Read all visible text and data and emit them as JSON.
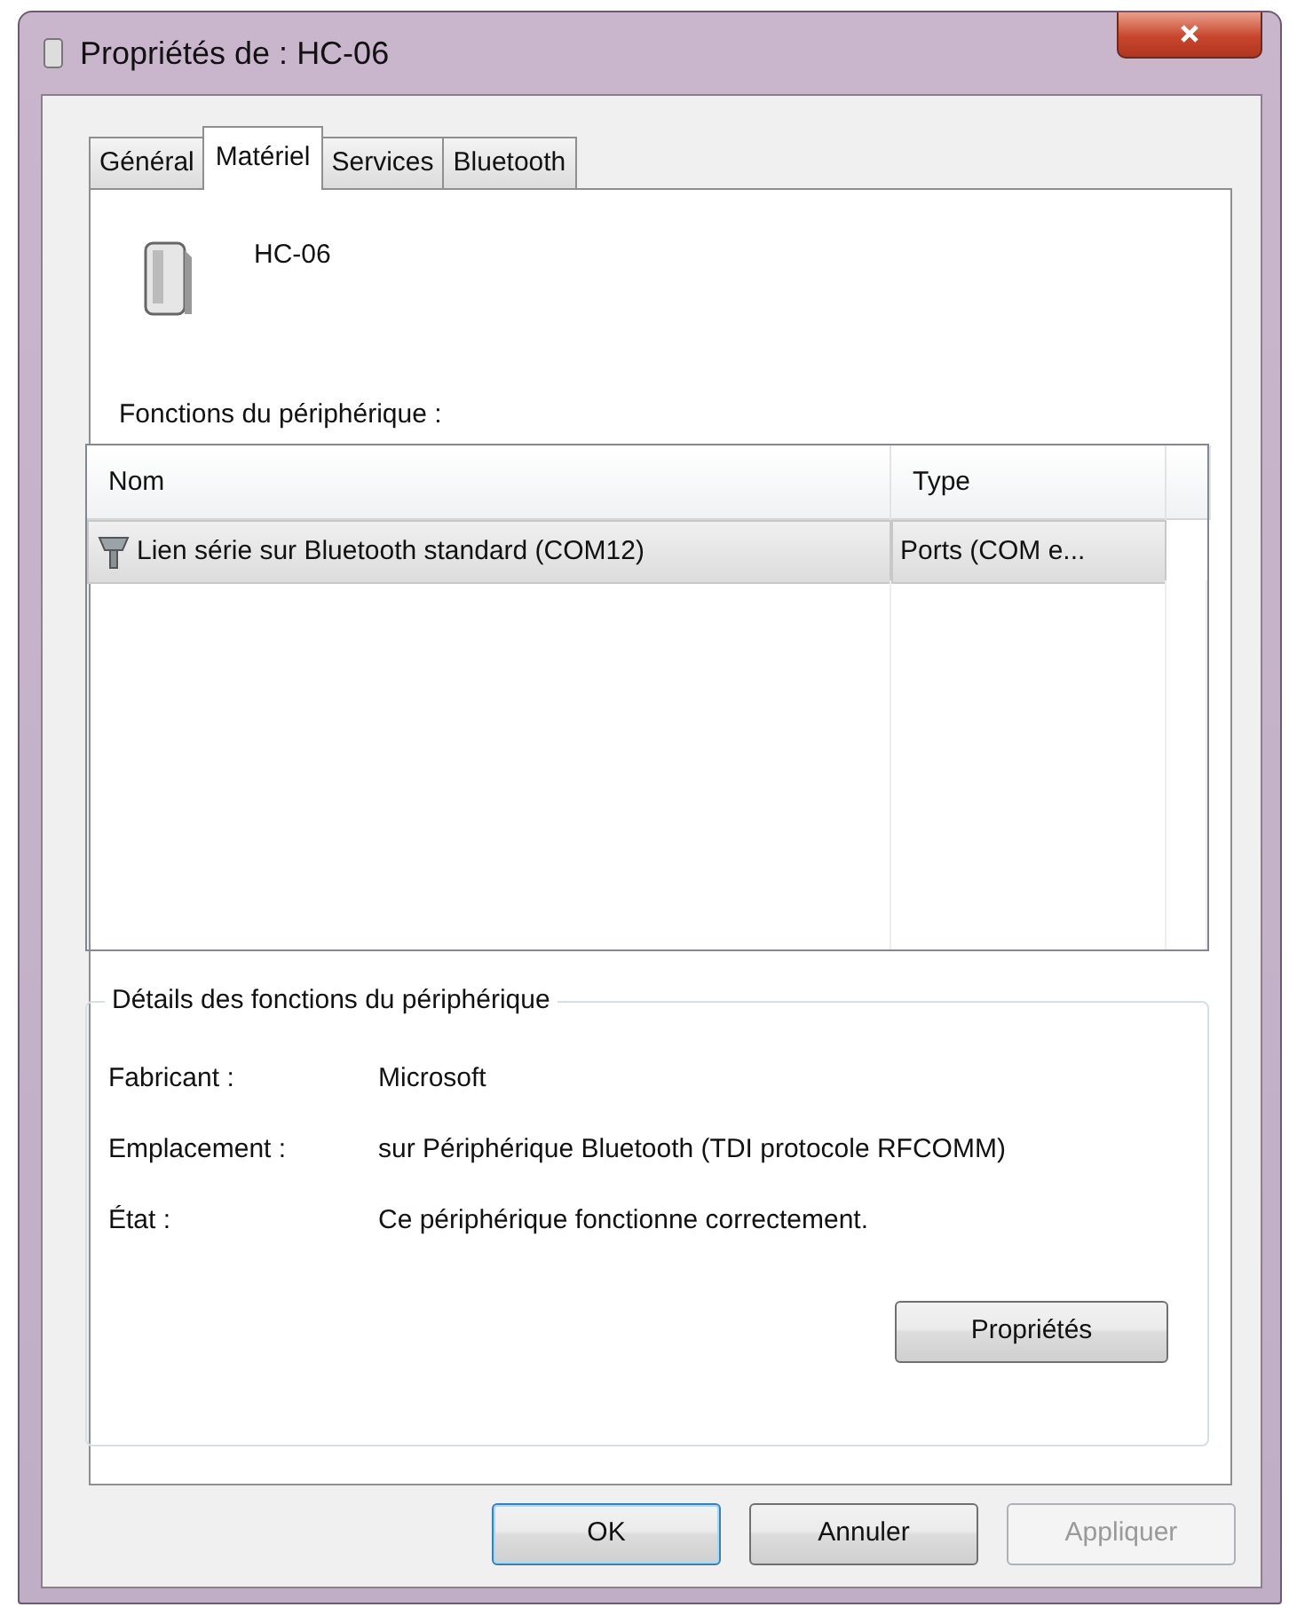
{
  "window": {
    "title": "Propriétés de : HC-06"
  },
  "tabs": [
    {
      "label": "Général",
      "selected": false
    },
    {
      "label": "Matériel",
      "selected": true
    },
    {
      "label": "Services",
      "selected": false
    },
    {
      "label": "Bluetooth",
      "selected": false
    }
  ],
  "device": {
    "name": "HC-06"
  },
  "functions": {
    "label": "Fonctions du périphérique :",
    "columns": [
      "Nom",
      "Type"
    ],
    "rows": [
      {
        "cells": [
          "Lien série sur Bluetooth standard (COM12)",
          "Ports (COM e..."
        ],
        "selected": true
      }
    ]
  },
  "details": {
    "legend": "Détails des fonctions du périphérique",
    "fields": [
      {
        "label": "Fabricant :",
        "value": "Microsoft"
      },
      {
        "label": "Emplacement :",
        "value": "sur Périphérique Bluetooth (TDI protocole RFCOMM)"
      },
      {
        "label": "État :",
        "value": "Ce périphérique fonctionne correctement."
      }
    ],
    "button": "Propriétés"
  },
  "buttons": [
    {
      "label": "OK",
      "default": true,
      "disabled": false
    },
    {
      "label": "Annuler",
      "default": false,
      "disabled": false
    },
    {
      "label": "Appliquer",
      "default": false,
      "disabled": true
    }
  ]
}
